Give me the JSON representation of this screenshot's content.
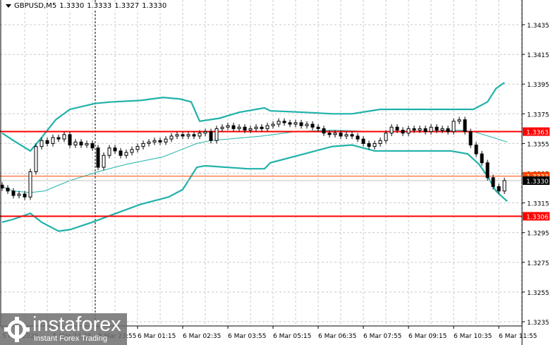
{
  "header": {
    "symbol": "GBPUSD,M5",
    "open": "1.3330",
    "high": "1.3333",
    "low": "1.3327",
    "close": "1.3330"
  },
  "watermark": {
    "brand": "instaforex",
    "tagline": "Instant Forex Trading"
  },
  "colors": {
    "band": "#20b2aa",
    "level": "#ff0000",
    "ask": "#ff4500",
    "bid": "#c0c0c0",
    "current_bg": "#000000"
  },
  "chart_data": {
    "type": "candlestick",
    "title": "GBPUSD,M5",
    "ylim": [
      1.3226,
      1.3452
    ],
    "y_ticks": [
      "1.3435",
      "1.3415",
      "1.3395",
      "1.3375",
      "1.3355",
      "1.3335",
      "1.3315",
      "1.3295",
      "1.3275",
      "1.3255",
      "1.3235"
    ],
    "x_ticks": [
      {
        "bar": 0,
        "label": "5 Mar 2026"
      },
      {
        "bar": 18,
        "label": "5 Mar 22:35"
      },
      {
        "bar": 34,
        "label": "5 Mar 23:55"
      },
      {
        "bar": 48,
        "label": "6 Mar 01:15"
      },
      {
        "bar": 64,
        "label": "6 Mar 02:35"
      },
      {
        "bar": 80,
        "label": "6 Mar 03:55"
      },
      {
        "bar": 96,
        "label": "6 Mar 05:15"
      },
      {
        "bar": 112,
        "label": "6 Mar 06:35"
      },
      {
        "bar": 128,
        "label": "6 Mar 07:55"
      },
      {
        "bar": 144,
        "label": "6 Mar 09:15"
      },
      {
        "bar": 160,
        "label": "6 Mar 10:35"
      },
      {
        "bar": 176,
        "label": "6 Mar 11:55"
      }
    ],
    "session_separator_bar": 33,
    "candle_step_bars": 2,
    "first_open": 1.3327,
    "closes": [
      1.3325,
      1.3323,
      1.332,
      1.3321,
      1.3319,
      1.3336,
      1.3353,
      1.3357,
      1.3355,
      1.3359,
      1.3358,
      1.3361,
      1.3354,
      1.3356,
      1.3354,
      1.3355,
      1.3352,
      1.3339,
      1.3347,
      1.3352,
      1.335,
      1.3347,
      1.3349,
      1.3351,
      1.3353,
      1.3355,
      1.3356,
      1.3357,
      1.3356,
      1.3358,
      1.336,
      1.3361,
      1.336,
      1.3361,
      1.336,
      1.3362,
      1.3363,
      1.3357,
      1.3365,
      1.3366,
      1.3367,
      1.3365,
      1.3366,
      1.3364,
      1.3365,
      1.3366,
      1.3365,
      1.3367,
      1.3368,
      1.337,
      1.3369,
      1.3368,
      1.3369,
      1.3367,
      1.3368,
      1.3366,
      1.3365,
      1.3362,
      1.3361,
      1.3362,
      1.336,
      1.3361,
      1.336,
      1.3358,
      1.3355,
      1.3353,
      1.3355,
      1.3357,
      1.3362,
      1.3366,
      1.3364,
      1.3362,
      1.3365,
      1.3364,
      1.3365,
      1.3363,
      1.3366,
      1.3364,
      1.3365,
      1.3363,
      1.337,
      1.3371,
      1.3363,
      1.3354,
      1.3348,
      1.3342,
      1.3332,
      1.3326,
      1.3323,
      1.333
    ],
    "bollinger": {
      "upper": [
        [
          0,
          1.3362
        ],
        [
          4,
          1.3357
        ],
        [
          10,
          1.335
        ],
        [
          14,
          1.3359
        ],
        [
          19,
          1.3371
        ],
        [
          24,
          1.3378
        ],
        [
          33,
          1.3382
        ],
        [
          39,
          1.3383
        ],
        [
          49,
          1.3384
        ],
        [
          57,
          1.3386
        ],
        [
          63,
          1.3385
        ],
        [
          67,
          1.3383
        ],
        [
          70,
          1.337
        ],
        [
          77,
          1.3372
        ],
        [
          84,
          1.3376
        ],
        [
          93,
          1.3379
        ],
        [
          95,
          1.3377
        ],
        [
          107,
          1.3376
        ],
        [
          117,
          1.3375
        ],
        [
          124,
          1.3375
        ],
        [
          134,
          1.3378
        ],
        [
          149,
          1.3378
        ],
        [
          159,
          1.3378
        ],
        [
          167,
          1.3378
        ],
        [
          172,
          1.3383
        ],
        [
          175,
          1.3392
        ],
        [
          178,
          1.3396
        ]
      ],
      "middle": [
        [
          0,
          1.3326
        ],
        [
          4,
          1.3323
        ],
        [
          10,
          1.3322
        ],
        [
          15,
          1.3323
        ],
        [
          24,
          1.333
        ],
        [
          34,
          1.3336
        ],
        [
          44,
          1.3341
        ],
        [
          57,
          1.3346
        ],
        [
          69,
          1.3355
        ],
        [
          74,
          1.3357
        ],
        [
          92,
          1.336
        ],
        [
          104,
          1.3363
        ],
        [
          117,
          1.3364
        ],
        [
          132,
          1.3363
        ],
        [
          149,
          1.3363
        ],
        [
          162,
          1.3364
        ],
        [
          167,
          1.3363
        ],
        [
          174,
          1.3359
        ],
        [
          179,
          1.3356
        ]
      ],
      "lower": [
        [
          0,
          1.3302
        ],
        [
          4,
          1.3304
        ],
        [
          10,
          1.3308
        ],
        [
          14,
          1.3302
        ],
        [
          20,
          1.3296
        ],
        [
          24,
          1.3297
        ],
        [
          32,
          1.3302
        ],
        [
          39,
          1.3307
        ],
        [
          49,
          1.3314
        ],
        [
          59,
          1.3319
        ],
        [
          64,
          1.3324
        ],
        [
          69,
          1.3339
        ],
        [
          72,
          1.334
        ],
        [
          87,
          1.3338
        ],
        [
          93,
          1.3338
        ],
        [
          95,
          1.3342
        ],
        [
          107,
          1.3348
        ],
        [
          117,
          1.3353
        ],
        [
          124,
          1.3354
        ],
        [
          132,
          1.335
        ],
        [
          149,
          1.335
        ],
        [
          159,
          1.335
        ],
        [
          165,
          1.3348
        ],
        [
          169,
          1.3341
        ],
        [
          172,
          1.3333
        ],
        [
          175,
          1.3323
        ],
        [
          179,
          1.3316
        ]
      ]
    },
    "levels": [
      {
        "price": 1.3363,
        "label": "1.3363",
        "kind": "level"
      },
      {
        "price": 1.3306,
        "label": "1.3306",
        "kind": "level"
      },
      {
        "price": 1.3333,
        "label": "1.3333",
        "kind": "ask"
      },
      {
        "price": 1.333,
        "label": "1.3330",
        "kind": "current"
      }
    ]
  }
}
